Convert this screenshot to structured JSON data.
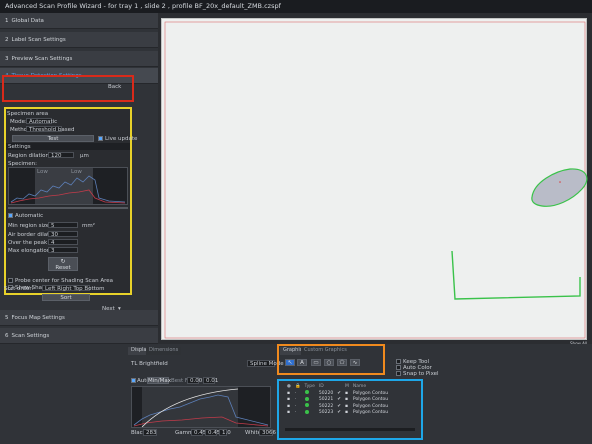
{
  "window": {
    "title": "Advanced Scan Profile Wizard -",
    "subtitle": "for tray 1 , slide 2 , profile BF_20x_default_ZMB.czspf"
  },
  "steps": [
    {
      "num": "1",
      "label": "Global Data"
    },
    {
      "num": "2",
      "label": "Label Scan Settings"
    },
    {
      "num": "3",
      "label": "Preview Scan Settings"
    },
    {
      "num": "4",
      "label": "Tissue Detection Settings"
    },
    {
      "num": "5",
      "label": "Focus Map Settings"
    },
    {
      "num": "6",
      "label": "Scan Settings"
    }
  ],
  "tissue": {
    "back_label": "Back",
    "header": "Specimen area",
    "mode_label": "Mode:",
    "mode_value": "Automatic",
    "method_label": "Method:",
    "method_value": "Threshold based",
    "test_button": "Test",
    "live_update": "Live update",
    "settings_label": "Settings",
    "dilation_label": "Region dilation size:",
    "dilation_value": "120",
    "dilation_unit": "µm",
    "specimen_label": "Specimen:",
    "hist_left": "Low",
    "hist_right": "Low",
    "automatic_label": "Automatic",
    "min_region_label": "Min region size:",
    "min_region_value": "5",
    "min_region_unit": "mm²",
    "air_border_label": "Air border dilate:",
    "air_border_value": "30",
    "over_peak_label": "Over the peak factor:",
    "over_peak_value": "4",
    "max_elong_label": "Max elongation:",
    "max_elong_value": "3",
    "reset_label": "Reset",
    "probe_center": "Probe center for Shading Scan Area",
    "show_shading": "Show Shading Scan Area",
    "sort_order_label": "Sort order:",
    "sort_order_value": "Left Right Top Bottom",
    "sort_button": "Sort",
    "next_label": "Next"
  },
  "viewer": {
    "show_all": "Show All"
  },
  "bottom": {
    "tabs": [
      "Display",
      "Dimensions"
    ],
    "channel": "TL Brightfield",
    "spline_mode": "Spline Mode",
    "graphics_tab": "Graphics",
    "custom_graphics_tab": "Custom Graphics",
    "auto_label": "Auto",
    "minmax_label": "Min/Max",
    "bestfit_label": "Best Fit",
    "bestfit_a": "0.00",
    "bestfit_b": "0.01",
    "keep_tool": "Keep Tool",
    "auto_color": "Auto Color",
    "snap_pixel": "Snap to Pixel",
    "black_label": "Black",
    "black_value": "283",
    "gamma_label": "Gamma",
    "gamma_value": "0.45",
    "gamma_b": "0.45",
    "gamma_c": "1.0",
    "white_label": "White",
    "white_value": "3066",
    "table_headers": [
      "Type",
      "ID",
      "",
      "M",
      "Name"
    ],
    "rows": [
      {
        "id": "50220",
        "name": "Polygon Contou"
      },
      {
        "id": "50221",
        "name": "Polygon Contou"
      },
      {
        "id": "50222",
        "name": "Polygon Contou"
      },
      {
        "id": "50223",
        "name": "Polygon Contou"
      }
    ]
  },
  "colors": {
    "accent_blue": "#5aa0e8",
    "highlight_red": "#d92a1a",
    "highlight_yellow": "#e8d22a",
    "highlight_orange": "#f08a1e",
    "highlight_blue": "#1ea7e8",
    "contour_green": "#3ac24a"
  }
}
